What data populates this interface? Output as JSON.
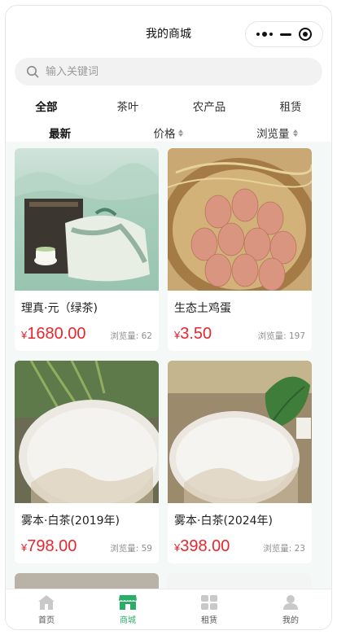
{
  "header": {
    "title": "我的商城"
  },
  "search": {
    "placeholder": "输入关键词"
  },
  "categories": [
    {
      "label": "全部",
      "active": true
    },
    {
      "label": "茶叶",
      "active": false
    },
    {
      "label": "农产品",
      "active": false
    },
    {
      "label": "租赁",
      "active": false
    }
  ],
  "sorts": [
    {
      "label": "最新",
      "active": true
    },
    {
      "label": "价格",
      "active": false
    },
    {
      "label": "浏览量",
      "active": false
    }
  ],
  "products": [
    {
      "name": "理真·元（绿茶)",
      "currency": "¥",
      "price": "1680.00",
      "views": "浏览量: 62"
    },
    {
      "name": "生态土鸡蛋",
      "currency": "¥",
      "price": "3.50",
      "views": "浏览量: 197"
    },
    {
      "name": "雾本·白茶(2019年)",
      "currency": "¥",
      "price": "798.00",
      "views": "浏览量: 59"
    },
    {
      "name": "雾本·白茶(2024年)",
      "currency": "¥",
      "price": "398.00",
      "views": "浏览量: 23"
    }
  ],
  "tabbar": [
    {
      "label": "首页",
      "icon": "home-icon",
      "active": false
    },
    {
      "label": "商城",
      "icon": "store-icon",
      "active": true
    },
    {
      "label": "租赁",
      "icon": "grid-icon",
      "active": false
    },
    {
      "label": "我的",
      "icon": "person-icon",
      "active": false
    }
  ],
  "colors": {
    "accent": "#2aae67",
    "price": "#e8262e"
  }
}
